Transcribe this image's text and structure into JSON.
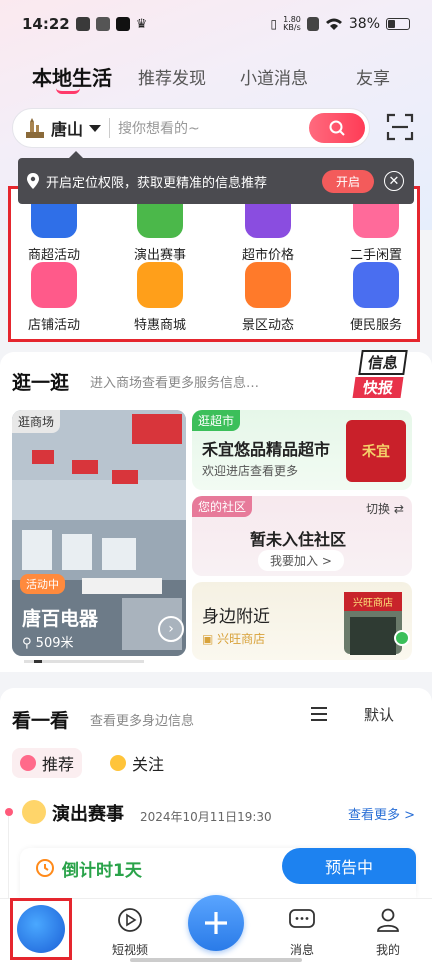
{
  "status_bar": {
    "time": "14:22",
    "net_speed": "1.80\nKB/s",
    "battery": "38%"
  },
  "top_tabs": [
    {
      "label": "本地生活",
      "active": true
    },
    {
      "label": "推荐发现",
      "active": false
    },
    {
      "label": "小道消息",
      "active": false
    },
    {
      "label": "友享",
      "active": false
    }
  ],
  "search": {
    "city": "唐山",
    "placeholder": "搜你想看的~"
  },
  "location_tip": {
    "text": "开启定位权限，获取更精准的信息推荐",
    "open_label": "开启"
  },
  "services": [
    {
      "label": "商超活动",
      "icon": "mall-activity-icon",
      "color": "#2f6fe8"
    },
    {
      "label": "演出赛事",
      "icon": "show-event-icon",
      "color": "#4bb84a"
    },
    {
      "label": "超市价格",
      "icon": "supermarket-price-icon",
      "color": "#8a4de0"
    },
    {
      "label": "二手闲置",
      "icon": "second-hand-icon",
      "color": "#ff6a9a"
    },
    {
      "label": "店铺活动",
      "icon": "store-activity-icon",
      "color": "#ff5a8a"
    },
    {
      "label": "特惠商城",
      "icon": "discount-mall-icon",
      "color": "#ff9f1a"
    },
    {
      "label": "景区动态",
      "icon": "scenic-news-icon",
      "color": "#ff7a2a"
    },
    {
      "label": "便民服务",
      "icon": "convenience-service-icon",
      "color": "#4a6ef0"
    }
  ],
  "browse": {
    "title": "逛一逛",
    "subtitle": "进入商场查看更多服务信息…",
    "news_badge": [
      "信息",
      "快报"
    ],
    "mall": {
      "tag": "逛商场",
      "status": "活动中",
      "name": "唐百电器",
      "distance": "509米"
    },
    "supermarket": {
      "tag": "逛超市",
      "title": "禾宜悠品精品超市",
      "subtitle": "欢迎进店查看更多",
      "logo_text": "禾宜"
    },
    "community": {
      "tag": "您的社区",
      "switch_label": "切换",
      "title": "暂未入住社区",
      "action": "我要加入 >"
    },
    "nearby": {
      "title": "身边附近",
      "store": "兴旺商店",
      "sign_text": "兴旺商店"
    }
  },
  "look": {
    "title": "看一看",
    "subtitle": "查看更多身边信息",
    "sort_label": "默认",
    "chips": [
      {
        "label": "推荐"
      },
      {
        "label": "关注"
      }
    ],
    "event": {
      "title": "演出赛事",
      "date": "2024年10月11日19:30",
      "more": "查看更多 >",
      "countdown": "倒计时1天",
      "status": "预告中"
    }
  },
  "bottom_nav": [
    {
      "label": "短视频",
      "icon": "play-circle-icon"
    },
    {
      "label": "消息",
      "icon": "message-icon"
    },
    {
      "label": "我的",
      "icon": "user-icon"
    }
  ]
}
